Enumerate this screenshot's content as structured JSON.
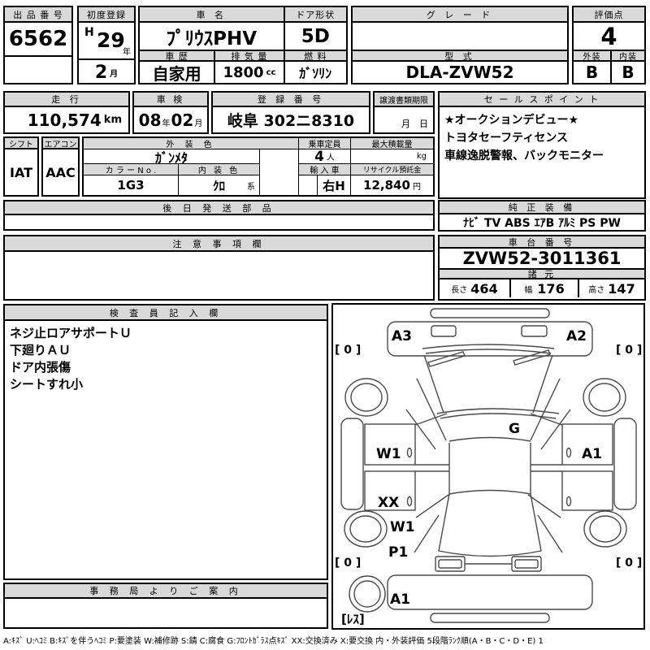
{
  "top": {
    "auction_no": {
      "label": "出 品 番 号",
      "value": "6562"
    },
    "first_reg": {
      "label": "初度登録",
      "era": "H",
      "year": "29",
      "year_unit": "年",
      "month": "2",
      "month_unit": "月"
    },
    "car_name": {
      "label": "車  名",
      "value": "ﾌﾟﾘｳｽPHV"
    },
    "door": {
      "label": "ドア形状",
      "value": "5D"
    },
    "grade": {
      "label": "グ レ ー ド",
      "value": ""
    },
    "score": {
      "label": "評価点",
      "value": "4"
    },
    "history": {
      "label": "車 歴",
      "value": "自家用"
    },
    "displacement": {
      "label": "排 気 量",
      "value": "1800",
      "unit": "cc"
    },
    "fuel": {
      "label": "燃 料",
      "value": "ｶﾞｿﾘﾝ"
    },
    "model_code": {
      "label": "型 式",
      "value": "DLA-ZVW52"
    },
    "exterior": {
      "label": "外装",
      "value": "B"
    },
    "interior": {
      "label": "内装",
      "value": "B"
    }
  },
  "row2": {
    "mileage": {
      "label": "走 行",
      "value": "110,574",
      "unit": "km"
    },
    "shaken": {
      "label": "車 検",
      "year": "08",
      "year_unit": "年",
      "month": "02",
      "month_unit": "月"
    },
    "reg_no": {
      "label": "登 録 番 号",
      "value": "岐阜 302ニ8310"
    },
    "transfer": {
      "label": "譲渡書類期限",
      "value": "月　日"
    },
    "sales_point": {
      "label": "セ ー ル ス ポ イ ン ト",
      "lines": [
        "★オークションデビュー★",
        "トヨタセーフティセンス",
        "車線逸脱警報、バックモニター"
      ]
    }
  },
  "row3": {
    "shift": {
      "label": "シフト",
      "value": "IAT"
    },
    "aircon": {
      "label": "エアコン",
      "value": "AAC"
    },
    "ext_color": {
      "label": "外 装 色",
      "value": "ｶﾞﾝﾒﾀ"
    },
    "capacity": {
      "label": "乗車定員",
      "value": "4",
      "unit": "人"
    },
    "max_load": {
      "label": "最大積載量",
      "unit": "kg"
    },
    "color_no": {
      "label": "カ ラ ー N o .",
      "value": "1G3"
    },
    "int_color": {
      "label": "内 装 色",
      "value": "ｸﾛ",
      "suffix": "系"
    },
    "import_car": {
      "label": "輸 入 車",
      "value": "右H"
    },
    "recycle": {
      "label": "リサイクル預託金",
      "value": "12,840",
      "unit": "円"
    }
  },
  "sections": {
    "later_parts": {
      "label": "後 日 発 送 部 品",
      "value": ""
    },
    "equipment": {
      "label": "純 正 装 備",
      "value": "ﾅﾋﾞ  TV  ABS  ｴｱB  ｱﾙﾐ  PS  PW"
    },
    "caution": {
      "label": "注 意 事 項 欄",
      "value": ""
    },
    "chassis": {
      "label": "車 台 番 号",
      "value": "ZVW52-3011361"
    },
    "specs": {
      "label": "諸 元",
      "length_label": "長さ",
      "length": "464",
      "width_label": "幅",
      "width": "176",
      "height_label": "高さ",
      "height": "147"
    },
    "inspector": {
      "label": "検 査 員 記 入 欄",
      "lines": [
        "ネジ止ロアサポートＵ",
        "下廻りＡＵ",
        "ドア内張傷",
        "シートすれ小"
      ]
    },
    "office": {
      "label": "事 務 局 よ り ご 案 内",
      "value": ""
    }
  },
  "diagram": {
    "labels": {
      "hood_left": "A3",
      "hood_right": "A2",
      "tire_fl": "[ 0 ]",
      "tire_fr": "[ 0 ]",
      "glass": "G",
      "door_fl": "W1",
      "door_fr": "A1",
      "door_rl": "XX",
      "quarter_l": "W1",
      "pillar_l": "P1",
      "tire_rl": "[ 0 ]",
      "tire_rr": "[ 0 ]",
      "rear_bumper": "A1",
      "spare": "[ﾚｽ]"
    }
  },
  "legend": "A:ｷｽﾞ U:ﾍｺﾐ B:ｷｽﾞを伴うﾍｺﾐ P:要塗装 W:補修跡 S:錆 C:腐食 G:ﾌﾛﾝﾄｶﾞﾗｽ点ｷｽﾞ XX:交換済み X:要交換  内・外装評価 5段階ﾗﾝｸ順(A・B・C・D・E) 1"
}
